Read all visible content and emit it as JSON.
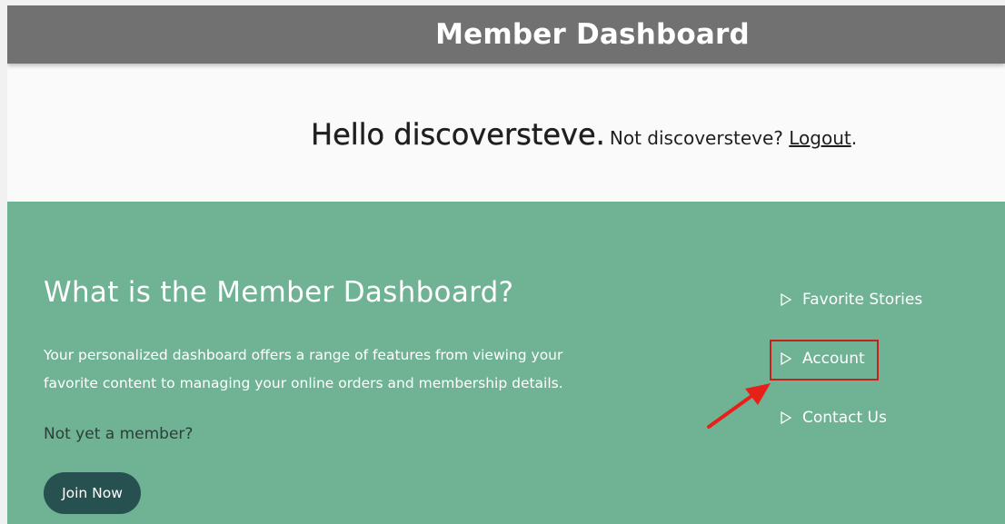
{
  "header": {
    "title": "Member Dashboard"
  },
  "greeting": {
    "hello": "Hello discoversteve.",
    "not_user": "Not discoversteve?",
    "logout": "Logout",
    "period": "."
  },
  "info": {
    "title": "What is the Member Dashboard?",
    "description_line1": "Your personalized dashboard offers a range of features from viewing your",
    "description_line2": "favorite content to managing your online orders and membership details.",
    "not_member": "Not yet a member?",
    "join_label": "Join Now"
  },
  "sidebar": {
    "items": [
      {
        "label": "Favorite Stories"
      },
      {
        "label": "Account"
      },
      {
        "label": "Contact Us"
      }
    ]
  },
  "colors": {
    "header_bg": "#717171",
    "panel_bg": "#70b294",
    "button_bg": "#265150",
    "highlight": "#c7201b"
  },
  "icons": [
    "triangle-right-outline-icon",
    "annotation-arrow-icon"
  ]
}
